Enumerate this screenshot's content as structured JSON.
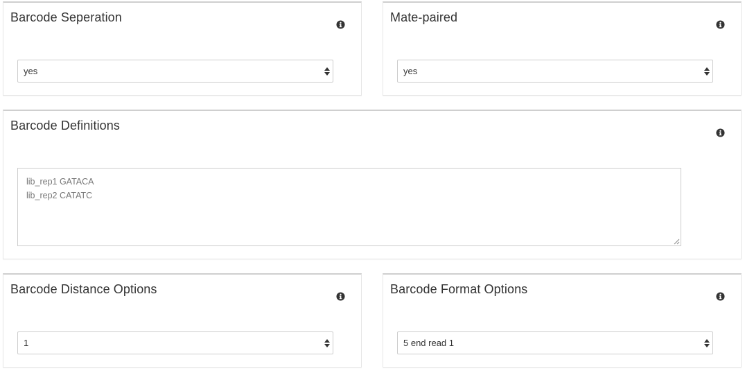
{
  "panels": {
    "barcode_separation": {
      "title": "Barcode Seperation",
      "icon": "info-circle-icon",
      "selected": "yes"
    },
    "mate_paired": {
      "title": "Mate-paired",
      "icon": "info-circle-icon",
      "selected": "yes"
    },
    "barcode_definitions": {
      "title": "Barcode Definitions",
      "icon": "info-circle-icon",
      "lines": [
        "lib_rep1 GATACA",
        "lib_rep2 CATATC"
      ]
    },
    "barcode_distance": {
      "title": "Barcode Distance Options",
      "icon": "info-circle-icon",
      "selected": "1"
    },
    "barcode_format": {
      "title": "Barcode Format Options",
      "icon": "info-circle-icon",
      "selected": "5 end read 1"
    }
  },
  "colors": {
    "text": "#333333",
    "textarea_text": "#777777",
    "border": "#cccccc",
    "panel_top_border": "#cfcfcf"
  }
}
